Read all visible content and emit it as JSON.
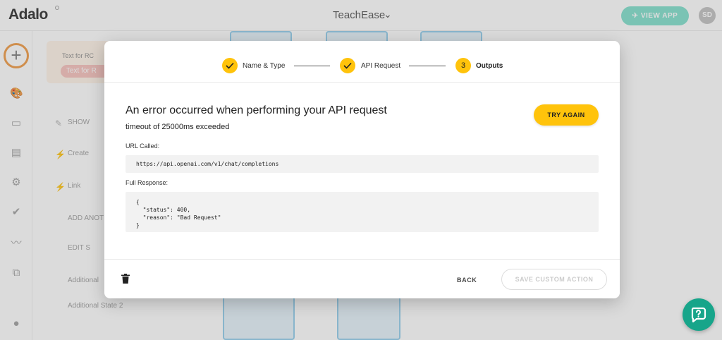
{
  "topbar": {
    "logo": "Adalo",
    "app_name": "TeachEase",
    "view_app_label": "VIEW APP",
    "avatar_initials": "SD"
  },
  "panel": {
    "card_label": "Text for RC",
    "card_chip": "Text for R",
    "rows": [
      "SHOW",
      "Create",
      "Link",
      "ADD ANOT",
      "EDIT S",
      "Additional",
      "Additional State 2"
    ]
  },
  "modal": {
    "steps": [
      {
        "label": "Name & Type",
        "status": "done"
      },
      {
        "label": "API Request",
        "status": "done"
      },
      {
        "label": "Outputs",
        "status": "active",
        "number": "3"
      }
    ],
    "error_title": "An error occurred when performing your API request",
    "error_detail": "timeout of 25000ms exceeded",
    "try_again_label": "TRY AGAIN",
    "url_label": "URL Called:",
    "url_value": "https://api.openai.com/v1/chat/completions",
    "response_label": "Full Response:",
    "response_value": "{\n  \"status\": 400,\n  \"reason\": \"Bad Request\"\n}",
    "back_label": "BACK",
    "save_label": "SAVE CUSTOM ACTION"
  },
  "colors": {
    "accent": "#ffc30b",
    "brand_teal": "#17a58a",
    "view_app_bg": "#8fe3d2"
  },
  "icons": {
    "step_done": "check-icon",
    "delete": "trash-icon",
    "help": "chat-question-icon"
  }
}
